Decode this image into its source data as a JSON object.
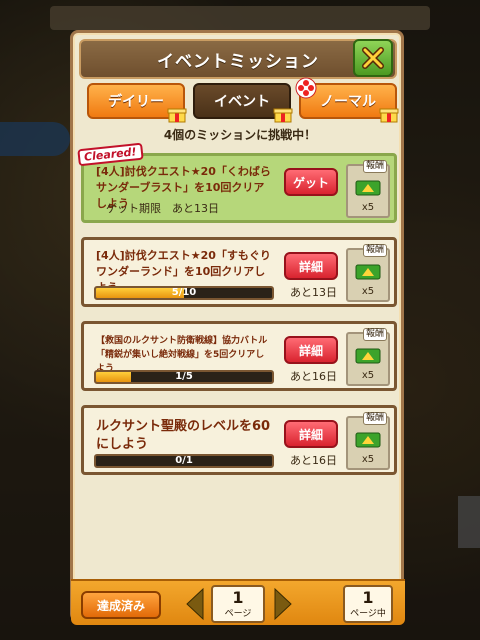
{
  "panel": {
    "title": "イベントミッション"
  },
  "tabs": [
    {
      "label": "デイリー",
      "active": false
    },
    {
      "label": "イベント",
      "active": true
    },
    {
      "label": "ノーマル",
      "active": false
    }
  ],
  "challenge_text": "4個のミッションに挑戦中！",
  "reward_label": "報酬",
  "missions": [
    {
      "text": "[4人]討伐クエスト★20「くわばらサンダーブラスト」を10回クリアしよう",
      "button": "ゲット",
      "remaining": "ゲット期限　あと13日",
      "reward_count": "x5",
      "cleared": true,
      "cleared_label": "Cleared!"
    },
    {
      "text": "[4人]討伐クエスト★20「すもぐりワンダーランド」を10回クリアしよう",
      "button": "詳細",
      "progress_label": "5/10",
      "progress": 0.5,
      "remaining": "あと13日",
      "reward_count": "x5"
    },
    {
      "text": "【救国のルクサント防衛戦線】協力バトル「精鋭が集いし絶対戦線」を5回クリアしよう",
      "button": "詳細",
      "progress_label": "1/5",
      "progress": 0.2,
      "remaining": "あと16日",
      "reward_count": "x5"
    },
    {
      "text": "ルクサント聖殿のレベルを60にしよう",
      "button": "詳細",
      "progress_label": "0/1",
      "progress": 0,
      "remaining": "あと16日",
      "reward_count": "x5"
    }
  ],
  "footer": {
    "completed_label": "達成済み",
    "page": "1",
    "page_unit": "ページ",
    "current_page": "1",
    "current_page_unit": "ページ中"
  },
  "colors": {
    "accent_orange": "#f07a11",
    "action_red": "#d9232f",
    "cleared_green": "#b6d77a",
    "close_green": "#4c9a22"
  }
}
